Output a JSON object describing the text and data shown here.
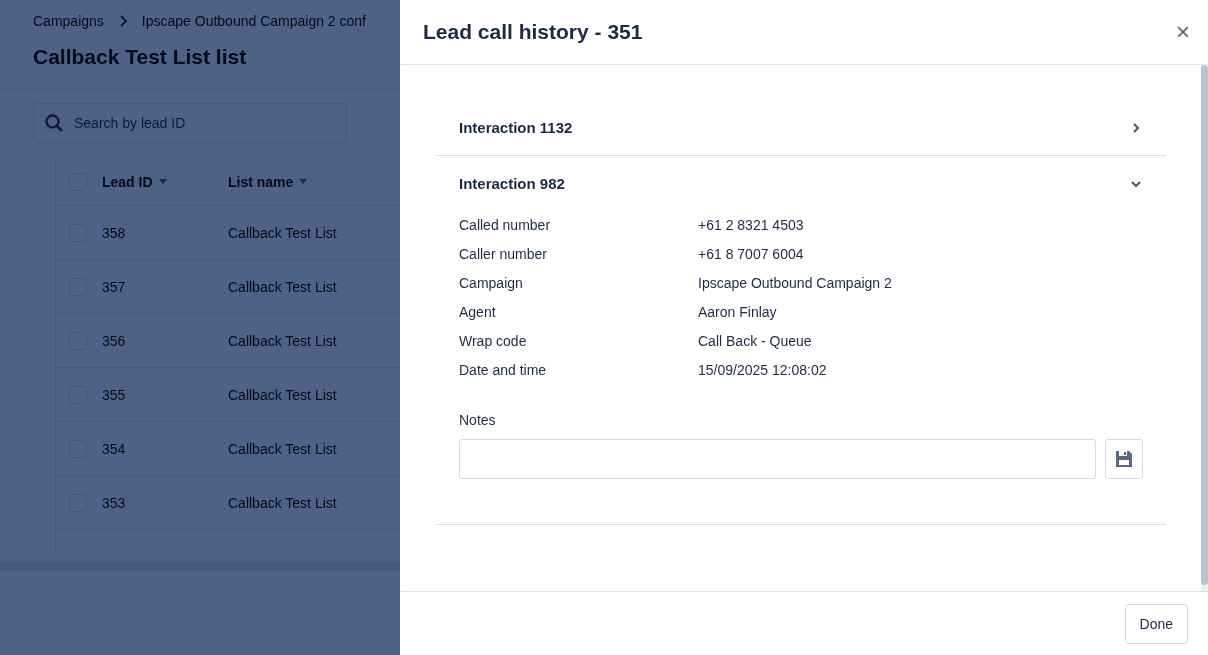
{
  "page": {
    "breadcrumbs": [
      {
        "label": "Campaigns"
      },
      {
        "label": "Ipscape Outbound Campaign 2 conf"
      }
    ],
    "title": "Callback Test List list",
    "search": {
      "placeholder": "Search by lead ID"
    },
    "table": {
      "all_checked": false,
      "columns": [
        "Lead ID",
        "List name"
      ],
      "rows": [
        {
          "lead_id": "358",
          "list_name": "Callback Test List",
          "checked": false
        },
        {
          "lead_id": "357",
          "list_name": "Callback Test List",
          "checked": false
        },
        {
          "lead_id": "356",
          "list_name": "Callback Test List",
          "checked": false
        },
        {
          "lead_id": "355",
          "list_name": "Callback Test List",
          "checked": false
        },
        {
          "lead_id": "354",
          "list_name": "Callback Test List",
          "checked": false
        },
        {
          "lead_id": "353",
          "list_name": "Callback Test List",
          "checked": false
        }
      ]
    }
  },
  "drawer": {
    "title": "Lead call history - 351",
    "close": "×",
    "interactions": [
      {
        "title": "Interaction 1132",
        "expanded": false
      },
      {
        "title": "Interaction 982",
        "expanded": true,
        "details": [
          {
            "label": "Called number",
            "value": "+61 2 8321 4503"
          },
          {
            "label": "Caller number",
            "value": "+61 8 7007 6004"
          },
          {
            "label": "Campaign",
            "value": "Ipscape Outbound Campaign 2"
          },
          {
            "label": "Agent",
            "value": "Aaron Finlay"
          },
          {
            "label": "Wrap code",
            "value": "Call Back - Queue"
          },
          {
            "label": "Date and time",
            "value": "15/09/2025 12:08:02"
          }
        ],
        "notes": {
          "label": "Notes"
        }
      }
    ],
    "done": "Done"
  }
}
